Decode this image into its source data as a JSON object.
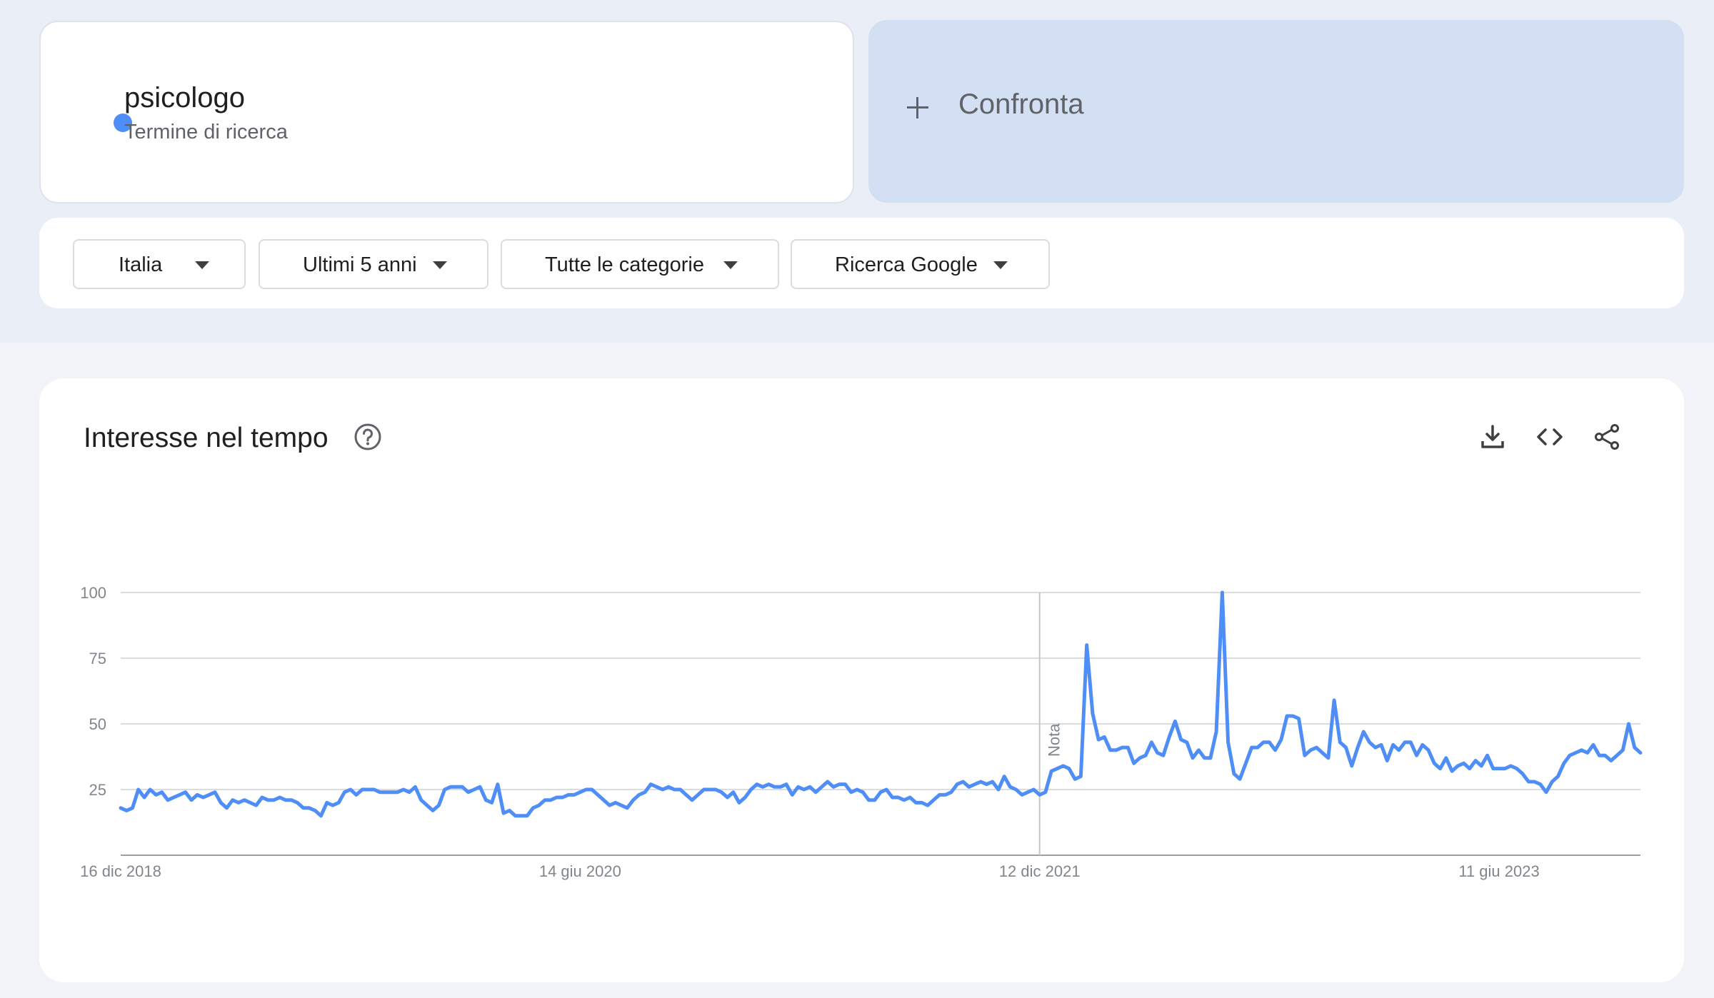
{
  "search_term": {
    "name": "psicologo",
    "type": "Termine di ricerca",
    "color": "#4f8ef7"
  },
  "compare": {
    "label": "Confronta",
    "icon": "plus-icon"
  },
  "filters": [
    {
      "label": "Italia",
      "icon": "dropdown-arrow-icon"
    },
    {
      "label": "Ultimi 5 anni",
      "icon": "dropdown-arrow-icon"
    },
    {
      "label": "Tutte le categorie",
      "icon": "dropdown-arrow-icon"
    },
    {
      "label": "Ricerca Google",
      "icon": "dropdown-arrow-icon"
    }
  ],
  "chart_card": {
    "title": "Interesse nel tempo",
    "icons": [
      "help-icon",
      "download-icon",
      "embed-icon",
      "share-icon"
    ]
  },
  "chart_data": {
    "type": "line",
    "title": "",
    "xlabel": "",
    "ylabel": "",
    "ylim": [
      0,
      100
    ],
    "yticks": [
      25,
      50,
      75,
      100
    ],
    "x_tick_labels": [
      "16 dic 2018",
      "14 giu 2020",
      "12 dic 2021",
      "11 giu 2023"
    ],
    "x_tick_indices": [
      0,
      78,
      156,
      234
    ],
    "annotation": {
      "label": "Nota",
      "index": 156
    },
    "grid": true,
    "series": [
      {
        "name": "psicologo",
        "color": "#4f8ef7",
        "values": [
          18,
          17,
          18,
          25,
          22,
          25,
          23,
          24,
          21,
          22,
          23,
          24,
          21,
          23,
          22,
          23,
          24,
          20,
          18,
          21,
          20,
          21,
          20,
          19,
          22,
          21,
          21,
          22,
          21,
          21,
          20,
          18,
          18,
          17,
          15,
          20,
          19,
          20,
          24,
          25,
          23,
          25,
          25,
          25,
          24,
          24,
          24,
          24,
          25,
          24,
          26,
          21,
          19,
          17,
          19,
          25,
          26,
          26,
          26,
          24,
          25,
          26,
          21,
          20,
          27,
          16,
          17,
          15,
          15,
          15,
          18,
          19,
          21,
          21,
          22,
          22,
          23,
          23,
          24,
          25,
          25,
          23,
          21,
          19,
          20,
          19,
          18,
          21,
          23,
          24,
          27,
          26,
          25,
          26,
          25,
          25,
          23,
          21,
          23,
          25,
          25,
          25,
          24,
          22,
          24,
          20,
          22,
          25,
          27,
          26,
          27,
          26,
          26,
          27,
          23,
          26,
          25,
          26,
          24,
          26,
          28,
          26,
          27,
          27,
          24,
          25,
          24,
          21,
          21,
          24,
          25,
          22,
          22,
          21,
          22,
          20,
          20,
          19,
          21,
          23,
          23,
          24,
          27,
          28,
          26,
          27,
          28,
          27,
          28,
          25,
          30,
          26,
          25,
          23,
          24,
          25,
          23,
          24,
          32,
          33,
          34,
          33,
          29,
          30,
          80,
          54,
          44,
          45,
          40,
          40,
          41,
          41,
          35,
          37,
          38,
          43,
          39,
          38,
          45,
          51,
          44,
          43,
          37,
          40,
          37,
          37,
          47,
          100,
          43,
          31,
          29,
          35,
          41,
          41,
          43,
          43,
          40,
          44,
          53,
          53,
          52,
          38,
          40,
          41,
          39,
          37,
          59,
          43,
          41,
          34,
          41,
          47,
          43,
          41,
          42,
          36,
          42,
          40,
          43,
          43,
          38,
          42,
          40,
          35,
          33,
          37,
          32,
          34,
          35,
          33,
          36,
          34,
          38,
          33,
          33,
          33,
          34,
          33,
          31,
          28,
          28,
          27,
          24,
          28,
          30,
          35,
          38,
          39,
          40,
          39,
          42,
          38,
          38,
          36,
          38,
          40,
          50,
          41,
          39
        ]
      }
    ]
  }
}
